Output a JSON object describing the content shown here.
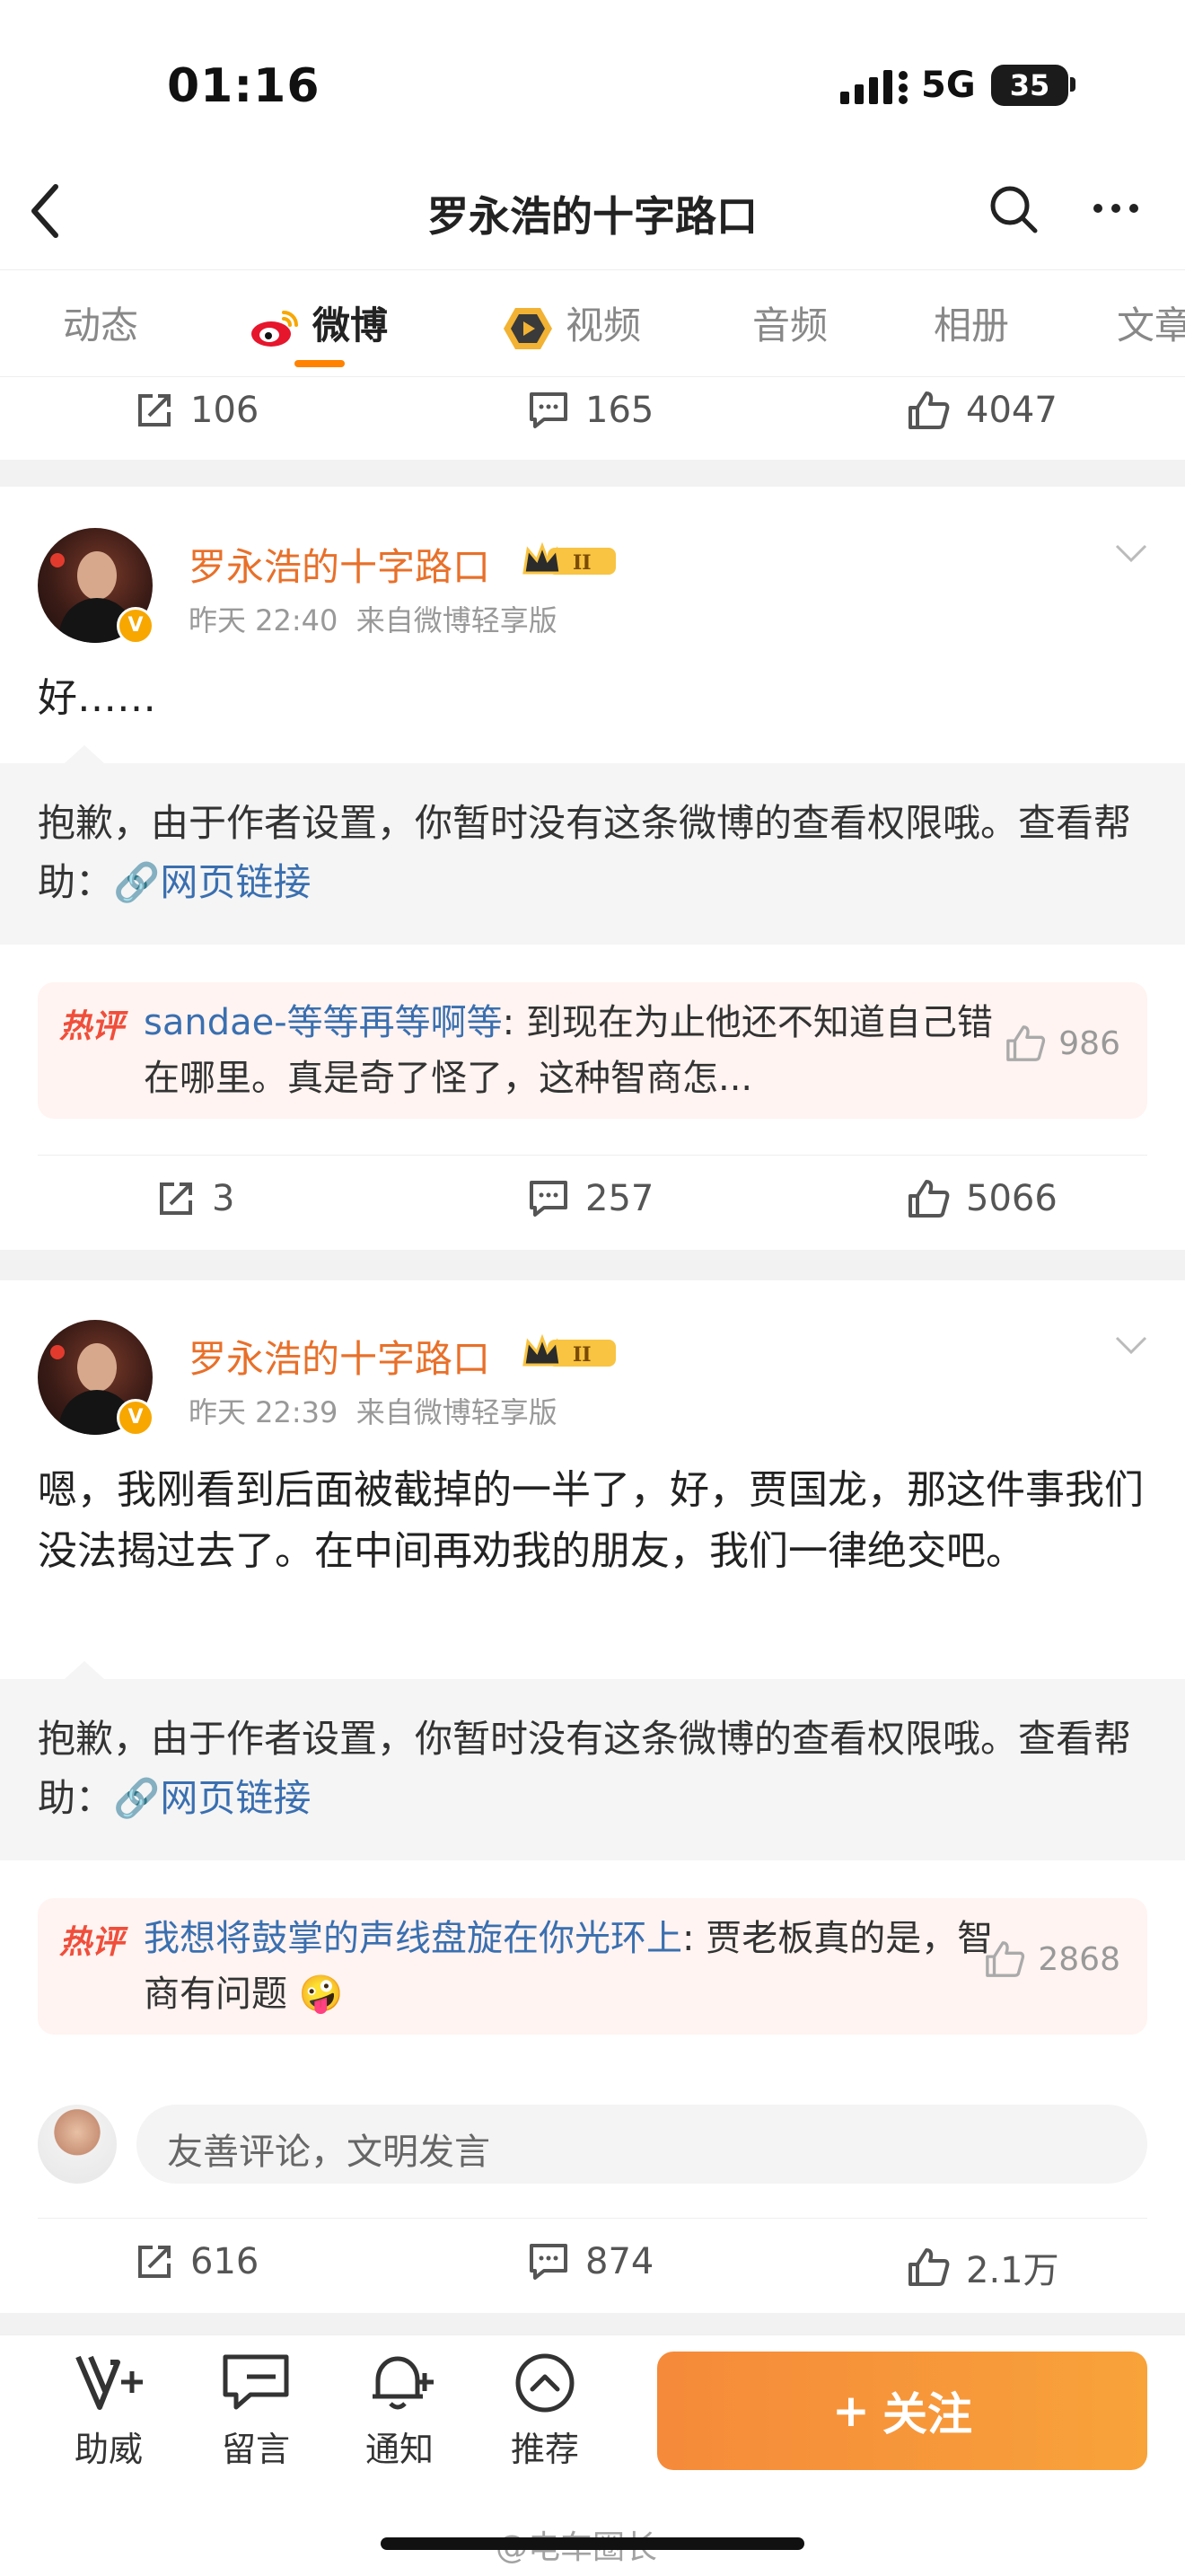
{
  "status_bar": {
    "time": "01:16",
    "network": "5G",
    "battery": "35"
  },
  "header": {
    "title": "罗永浩的十字路口"
  },
  "tabs": [
    {
      "label": "动态"
    },
    {
      "label": "微博"
    },
    {
      "label": "视频"
    },
    {
      "label": "音频"
    },
    {
      "label": "相册"
    },
    {
      "label": "文章"
    }
  ],
  "top_actions": {
    "reposts": "106",
    "comments": "165",
    "likes": "4047"
  },
  "posts": [
    {
      "author": "罗永浩的十字路口",
      "time": "昨天 22:40",
      "source": "来自微博轻享版",
      "text": "好……",
      "quoted_notice": "抱歉，由于作者设置，你暂时没有这条微博的查看权限哦。查看帮助：",
      "quoted_link": "网页链接",
      "hot_tag": "热评",
      "hot_user": "sandae-等等再等啊等",
      "hot_text": ": 到现在为止他还不知道自己错在哪里。真是奇了怪了，这种智商怎...",
      "hot_likes": "986",
      "reposts": "3",
      "comments": "257",
      "likes": "5066"
    },
    {
      "author": "罗永浩的十字路口",
      "time": "昨天 22:39",
      "source": "来自微博轻享版",
      "text": "嗯，我刚看到后面被截掉的一半了，好，贾国龙，那这件事我们没法揭过去了。在中间再劝我的朋友，我们一律绝交吧。",
      "quoted_notice": "抱歉，由于作者设置，你暂时没有这条微博的查看权限哦。查看帮助：",
      "quoted_link": "网页链接",
      "hot_tag": "热评",
      "hot_user": "我想将鼓掌的声线盘旋在你光环上",
      "hot_text": ": 贾老板真的是，智商有问题",
      "hot_likes": "2868",
      "comment_placeholder": "友善评论，文明发言",
      "reposts": "616",
      "comments": "874",
      "likes": "2.1万"
    }
  ],
  "bottom_bar": {
    "items": [
      {
        "label": "助威"
      },
      {
        "label": "留言"
      },
      {
        "label": "通知"
      },
      {
        "label": "推荐"
      }
    ],
    "follow_label": "关注"
  },
  "watermark": "@电车圈长",
  "colors": {
    "accent": "#ff8200",
    "author": "#e8702a",
    "link": "#3a6fb0",
    "hot": "#f04e3b"
  }
}
